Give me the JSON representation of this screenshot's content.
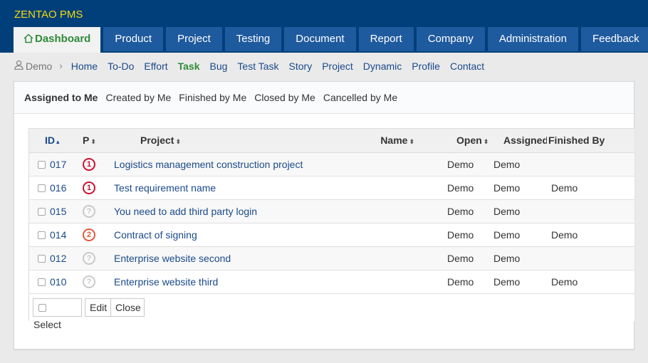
{
  "app": {
    "brand": "ZENTAO PMS"
  },
  "main_nav": [
    {
      "label": "Dashboard",
      "active": true
    },
    {
      "label": "Product"
    },
    {
      "label": "Project"
    },
    {
      "label": "Testing"
    },
    {
      "label": "Document"
    },
    {
      "label": "Report"
    },
    {
      "label": "Company"
    },
    {
      "label": "Administration"
    },
    {
      "label": "Feedback"
    }
  ],
  "sub_nav": {
    "user": "Demo",
    "separator": "›",
    "links": [
      "Home",
      "To-Do",
      "Effort",
      "Task",
      "Bug",
      "Test Task",
      "Story",
      "Project",
      "Dynamic",
      "Profile",
      "Contact"
    ],
    "active": "Task"
  },
  "filters": [
    "Assigned to Me",
    "Created by Me",
    "Finished by Me",
    "Closed by Me",
    "Cancelled by Me"
  ],
  "table": {
    "headers": {
      "id": "ID",
      "pri": "P",
      "project": "Project",
      "name": "Name",
      "opened": "Open",
      "assigned": "Assigned To",
      "finished": "Finished By"
    },
    "sort_asc": "▴",
    "sort_both": "⬍",
    "rows": [
      {
        "id": "017",
        "pri": "1",
        "project": "Logistics management construction project",
        "opened": "Demo",
        "assigned": "Demo",
        "finished": ""
      },
      {
        "id": "016",
        "pri": "1",
        "project": "Test requirement name",
        "opened": "Demo",
        "assigned": "Demo",
        "finished": "Demo"
      },
      {
        "id": "015",
        "pri": "?",
        "project": "You need to add third party login",
        "opened": "Demo",
        "assigned": "Demo",
        "finished": ""
      },
      {
        "id": "014",
        "pri": "2",
        "project": "Contract of signing",
        "opened": "Demo",
        "assigned": "Demo",
        "finished": "Demo"
      },
      {
        "id": "012",
        "pri": "?",
        "project": "Enterprise website second",
        "opened": "Demo",
        "assigned": "Demo",
        "finished": ""
      },
      {
        "id": "010",
        "pri": "?",
        "project": "Enterprise website third",
        "opened": "Demo",
        "assigned": "Demo",
        "finished": "Demo"
      }
    ]
  },
  "footer": {
    "select": "Select",
    "edit": "Edit",
    "close": "Close"
  },
  "colors": {
    "header_bg": "#003f7a",
    "tab_bg": "#1e5a9e",
    "brand": "#f5d90a",
    "active_green": "#2e8b3a",
    "link_blue": "#1a4a8a",
    "pri1": "#c8102e",
    "pri2": "#e0583b"
  },
  "icons": {
    "dashboard": "home-icon",
    "user": "user-icon"
  }
}
